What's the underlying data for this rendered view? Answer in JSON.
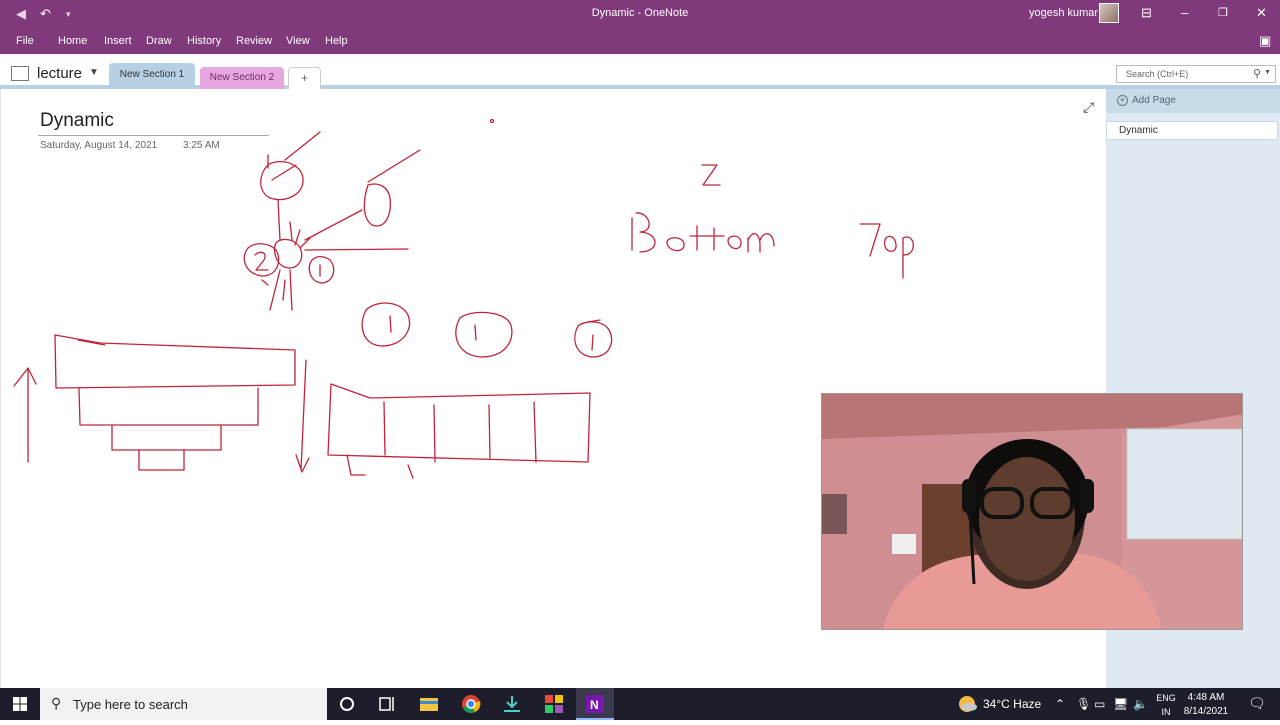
{
  "window": {
    "title": "Dynamic  -  OneNote",
    "user": "yogesh kumar"
  },
  "menu": [
    "File",
    "Home",
    "Insert",
    "Draw",
    "History",
    "Review",
    "View",
    "Help"
  ],
  "notebook": {
    "name": "lecture"
  },
  "sections": [
    {
      "label": "New Section 1",
      "active": true,
      "color": "#b7d0e4"
    },
    {
      "label": "New Section 2",
      "active": false,
      "color": "#e6a6de"
    }
  ],
  "add_section_label": "+",
  "search": {
    "placeholder": "Search (Ctrl+E)"
  },
  "page": {
    "title": "Dynamic",
    "date": "Saturday, August 14, 2021",
    "time": "3:25 AM"
  },
  "page_list": {
    "add_label": "Add Page",
    "items": [
      "Dynamic"
    ]
  },
  "taskbar": {
    "search_placeholder": "Type here to search",
    "weather": "34°C  Haze",
    "lang_top": "ENG",
    "lang_bottom": "IN",
    "time": "4:48 AM",
    "date": "8/14/2021"
  },
  "colors": {
    "ribbon": "#80397b",
    "ink": "#c0243a",
    "section1": "#b7d0e4",
    "section2": "#e6a6de",
    "taskbar": "#1d1d2b"
  }
}
